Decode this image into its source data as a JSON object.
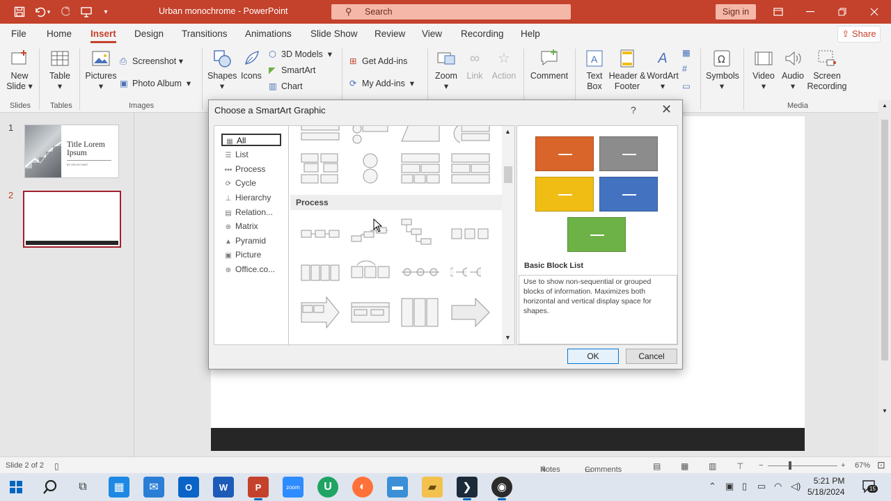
{
  "app": {
    "doc_title": "Urban monochrome  -  PowerPoint",
    "search_placeholder": "Search",
    "sign_in": "Sign in",
    "accent": "#c4412b"
  },
  "tabs": [
    "File",
    "Home",
    "Insert",
    "Design",
    "Transitions",
    "Animations",
    "Slide Show",
    "Review",
    "View",
    "Recording",
    "Help"
  ],
  "share_label": "Share",
  "ribbon": {
    "new_slide": "New Slide",
    "table": "Table",
    "pictures": "Pictures",
    "screenshot": "Screenshot",
    "photo_album": "Photo Album",
    "shapes": "Shapes",
    "icons": "Icons",
    "models_3d": "3D Models",
    "smartart": "SmartArt",
    "chart": "Chart",
    "get_addins": "Get Add-ins",
    "my_addins": "My Add-ins",
    "zoom": "Zoom",
    "link": "Link",
    "action": "Action",
    "comment": "Comment",
    "text_box": "Text Box",
    "header_footer": "Header & Footer",
    "wordart": "WordArt",
    "symbols": "Symbols",
    "video": "Video",
    "audio": "Audio",
    "screen_recording": "Screen Recording",
    "groups": {
      "slides": "Slides",
      "tables": "Tables",
      "images": "Images",
      "media": "Media"
    }
  },
  "slides": {
    "numbers": [
      "1",
      "2"
    ],
    "slide1_title": "Title Lorem Ipsum",
    "slide1_sub": "BY DELSH SMIT"
  },
  "dialog": {
    "title": "Choose a SmartArt Graphic",
    "help": "?",
    "close": "✕",
    "categories": [
      "All",
      "List",
      "Process",
      "Cycle",
      "Hierarchy",
      "Relation...",
      "Matrix",
      "Pyramid",
      "Picture",
      "Office.co..."
    ],
    "section_header": "Process",
    "preview_name": "Basic Block List",
    "preview_desc": "Use to show non-sequential or grouped blocks of information. Maximizes both horizontal and vertical display space for shapes.",
    "ok": "OK",
    "cancel": "Cancel",
    "block_colors": [
      "#d9652b",
      "#8c8c8c",
      "#f0bd15",
      "#4372c1",
      "#6db246"
    ]
  },
  "status": {
    "slide_info": "Slide 2 of 2",
    "notes": "Notes",
    "comments": "Comments",
    "zoom": "67%"
  },
  "taskbar": {
    "time": "5:21 PM",
    "date": "5/18/2024",
    "notifications": "15"
  }
}
